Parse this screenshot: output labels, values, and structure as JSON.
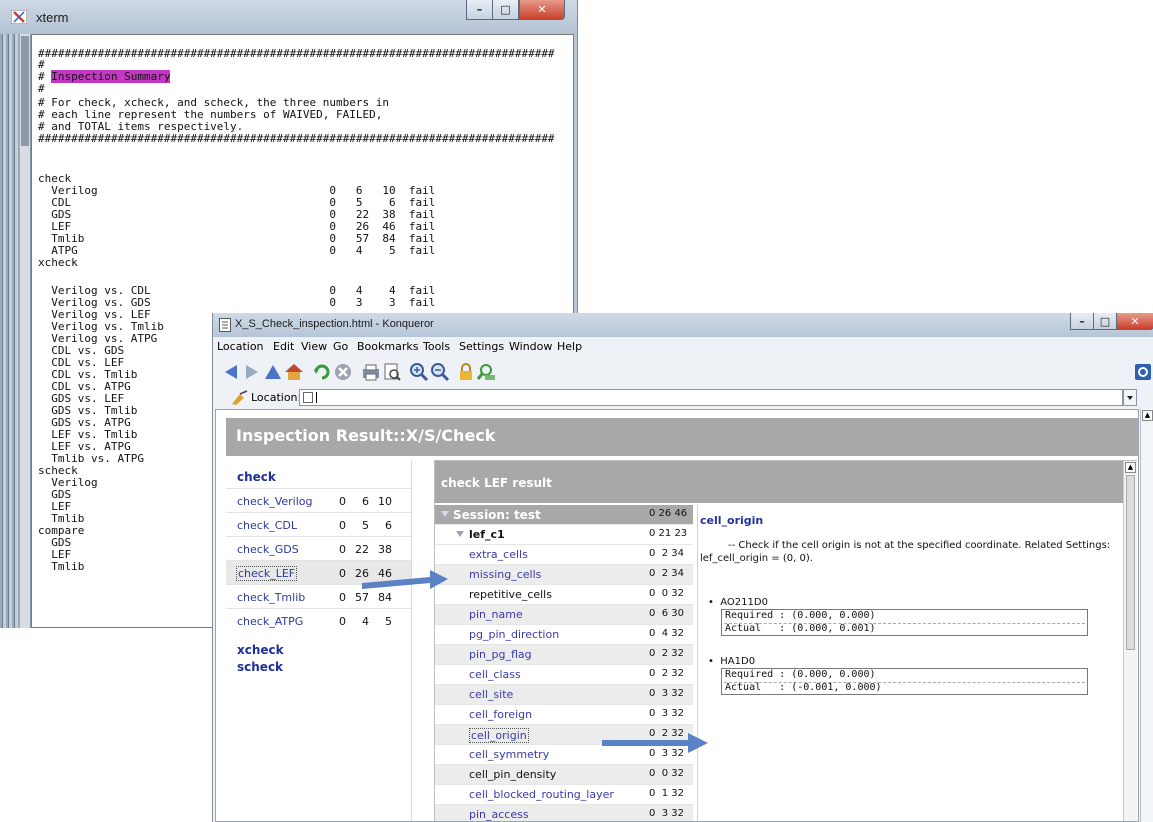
{
  "xterm": {
    "title": "xterm",
    "lines": [
      "##############################################################################",
      "#",
      "# Inspection Summary",
      "#",
      "# For check, xcheck, and scheck, the three numbers in",
      "# each line represent the numbers of WAIVED, FAILED,",
      "# and TOTAL items respectively.",
      "##############################################################################",
      "",
      "check",
      "  Verilog                                   0   6   10  fail",
      "  CDL                                       0   5    6  fail",
      "  GDS                                       0   22  38  fail",
      "  LEF                                       0   26  46  fail",
      "  Tmlib                                     0   57  84  fail",
      "  ATPG                                      0   4    5  fail",
      "xcheck",
      "  Verilog vs. CDL                           0   4    4  fail",
      "  Verilog vs. GDS                           0   3    3  fail",
      "  Verilog vs. LEF",
      "  Verilog vs. Tmlib",
      "  Verilog vs. ATPG",
      "  CDL vs. GDS",
      "  CDL vs. LEF",
      "  CDL vs. Tmlib",
      "  CDL vs. ATPG",
      "  GDS vs. LEF",
      "  GDS vs. Tmlib",
      "  GDS vs. ATPG",
      "  LEF vs. Tmlib",
      "  LEF vs. ATPG",
      "  Tmlib vs. ATPG",
      "scheck",
      "  Verilog",
      "  GDS",
      "  LEF",
      "  Tmlib",
      "compare",
      "  GDS",
      "  LEF",
      "  Tmlib"
    ],
    "highlight": "Inspection Summary"
  },
  "konqueror": {
    "title": "X_S_Check_inspection.html - Konqueror",
    "menu": [
      "Location",
      "Edit",
      "View",
      "Go",
      "Bookmarks",
      "Tools",
      "Settings",
      "Window",
      "Help"
    ],
    "location_label": "Location:",
    "location_value": "",
    "toolbar_icons": [
      "back-icon",
      "forward-icon",
      "up-icon",
      "home-icon",
      "reload-icon",
      "stop-icon",
      "print-icon",
      "print-preview-icon",
      "zoom-in-icon",
      "zoom-out-icon",
      "security-lock-icon",
      "find-icon"
    ],
    "page_title": "Inspection Result::X/S/Check",
    "nav": {
      "check_heading": "check",
      "rows": [
        {
          "label": "check_Verilog",
          "w": "0",
          "f": "6",
          "t": "10"
        },
        {
          "label": "check_CDL",
          "w": "0",
          "f": "5",
          "t": "6"
        },
        {
          "label": "check_GDS",
          "w": "0",
          "f": "22",
          "t": "38"
        },
        {
          "label": "check_LEF",
          "w": "0",
          "f": "26",
          "t": "46"
        },
        {
          "label": "check_Tmlib",
          "w": "0",
          "f": "57",
          "t": "84"
        },
        {
          "label": "check_ATPG",
          "w": "0",
          "f": "4",
          "t": "5"
        }
      ],
      "xcheck_heading": "xcheck",
      "scheck_heading": "scheck"
    },
    "result": {
      "title": "check LEF result",
      "session": {
        "label": "Session: test",
        "values": "0 26 46"
      },
      "group": {
        "label": "lef_c1",
        "values": "0 21 23"
      },
      "items": [
        {
          "label": "extra_cells",
          "values": "0  2 34",
          "link": true
        },
        {
          "label": "missing_cells",
          "values": "0  2 34",
          "link": true
        },
        {
          "label": "repetitive_cells",
          "values": "0  0 32",
          "link": false
        },
        {
          "label": "pin_name",
          "values": "0  6 30",
          "link": true
        },
        {
          "label": "pg_pin_direction",
          "values": "0  4 32",
          "link": true
        },
        {
          "label": "pin_pg_flag",
          "values": "0  2 32",
          "link": true
        },
        {
          "label": "cell_class",
          "values": "0  2 32",
          "link": true
        },
        {
          "label": "cell_site",
          "values": "0  3 32",
          "link": true
        },
        {
          "label": "cell_foreign",
          "values": "0  3 32",
          "link": true
        },
        {
          "label": "cell_origin",
          "values": "0  2 32",
          "link": true
        },
        {
          "label": "cell_symmetry",
          "values": "0  3 32",
          "link": true
        },
        {
          "label": "cell_pin_density",
          "values": "0  0 32",
          "link": false
        },
        {
          "label": "cell_blocked_routing_layer",
          "values": "0  1 32",
          "link": true
        },
        {
          "label": "pin_access",
          "values": "0  3 32",
          "link": true
        }
      ]
    },
    "detail": {
      "title": "cell_origin",
      "description": "-- Check if the cell origin is not at the specified coordinate. Related Settings: lef_cell_origin = (0, 0).",
      "cells": [
        {
          "name": "AO211D0",
          "required": "Required : (0.000, 0.000)",
          "actual": "Actual   : (0.000, 0.001)"
        },
        {
          "name": "HA1D0",
          "required": "Required : (0.000, 0.000)",
          "actual": "Actual   : (-0.001, 0.000)"
        }
      ]
    }
  },
  "colors": {
    "highlight": "#c437c4",
    "header_gray": "#a8a8a8",
    "link": "#3a3aa6",
    "arrow": "#5b82c4"
  }
}
